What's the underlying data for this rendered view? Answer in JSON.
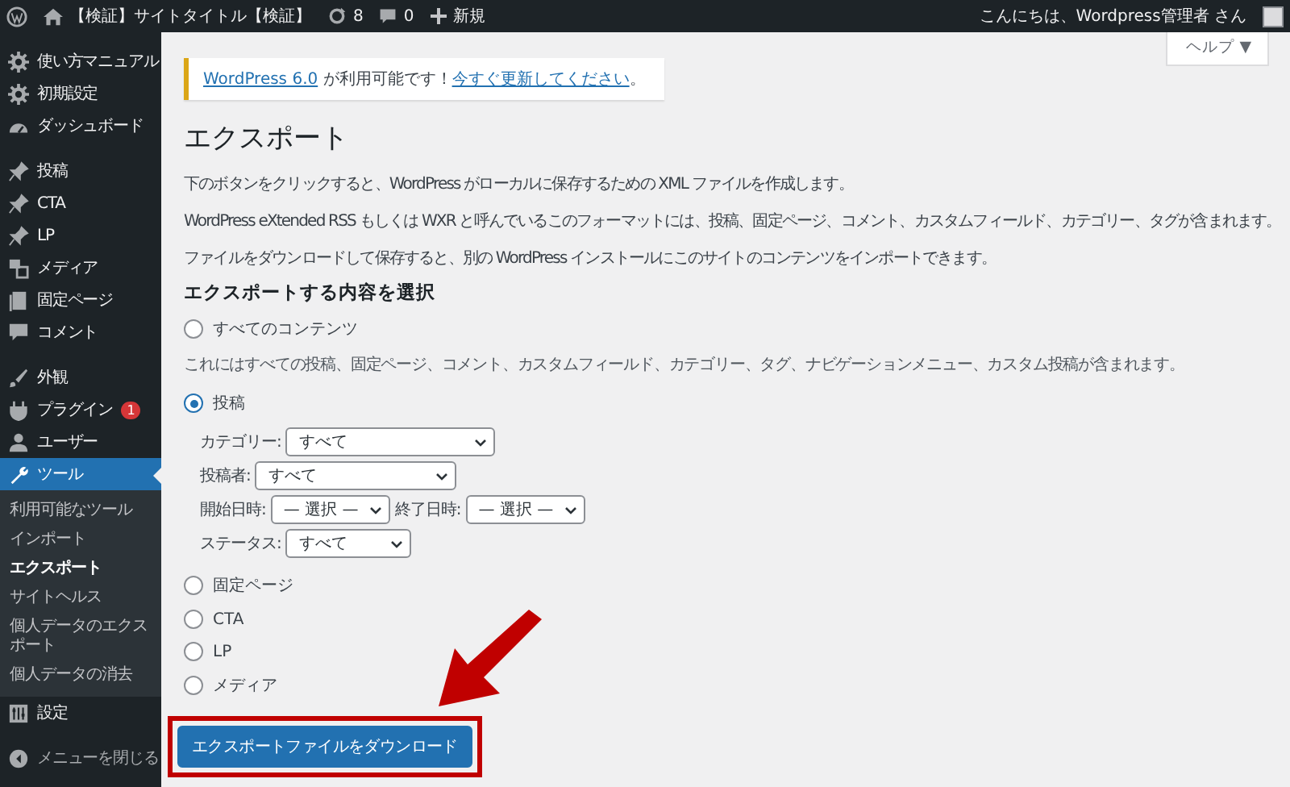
{
  "admin_bar": {
    "site_title": "【検証】サイトタイトル【検証】",
    "updates": "8",
    "comments": "0",
    "new_label": "新規",
    "greeting": "こんにちは、Wordpress管理者 さん"
  },
  "sidebar": {
    "groups": [
      {
        "items": [
          {
            "label": "使い方マニュアル",
            "selected": false
          },
          {
            "label": "初期設定",
            "selected": false
          },
          {
            "label": "ダッシュボード",
            "selected": false
          }
        ]
      },
      {
        "items": [
          {
            "label": "投稿",
            "selected": false
          },
          {
            "label": "CTA",
            "selected": false
          },
          {
            "label": "LP",
            "selected": false
          },
          {
            "label": "メディア",
            "selected": false
          },
          {
            "label": "固定ページ",
            "selected": false
          },
          {
            "label": "コメント",
            "selected": false
          }
        ]
      },
      {
        "items": [
          {
            "label": "外観",
            "selected": false
          },
          {
            "label": "プラグイン",
            "selected": false,
            "badge": "1"
          },
          {
            "label": "ユーザー",
            "selected": false
          },
          {
            "label": "ツール",
            "selected": true,
            "submenu": [
              {
                "label": "利用可能なツール",
                "selected": false
              },
              {
                "label": "インポート",
                "selected": false
              },
              {
                "label": "エクスポート",
                "selected": true
              },
              {
                "label": "サイトヘルス",
                "selected": false
              },
              {
                "label": "個人データのエクスポート",
                "selected": false
              },
              {
                "label": "個人データの消去",
                "selected": false
              }
            ]
          },
          {
            "label": "設定",
            "selected": false
          }
        ]
      }
    ],
    "collapse_label": "メニューを閉じる"
  },
  "help_tab": "ヘルプ ▼",
  "notice": {
    "link": "WordPress 6.0",
    "text": "が利用可能です！",
    "action": "今すぐ更新してください",
    "end": "。"
  },
  "page_title": "エクスポート",
  "intro": [
    "下のボタンをクリックすると、WordPress がローカルに保存するための XML ファイルを作成します。",
    "WordPress eXtended RSS もしくは WXR と呼んでいるこのフォーマットには、投稿、固定ページ、コメント、カスタムフィールド、カテゴリー、タグが含まれます。",
    "ファイルをダウンロードして保存すると、別の WordPress インストールにこのサイトのコンテンツをインポートできます。"
  ],
  "section_title": "エクスポートする内容を選択",
  "options": [
    {
      "label": "すべてのコンテンツ",
      "selected": false,
      "description": "これにはすべての投稿、固定ページ、コメント、カスタムフィールド、カテゴリー、タグ、ナビゲーションメニュー、カスタム投稿が含まれます。"
    },
    {
      "label": "投稿",
      "selected": true,
      "filter_rows": [
        [
          {
            "label": "カテゴリー:",
            "value": "すべて"
          }
        ],
        [
          {
            "label": "投稿者:",
            "value": "すべて"
          }
        ],
        [
          {
            "label": "開始日時:",
            "value": "— 選択 —"
          },
          {
            "label": "終了日時:",
            "value": "— 選択 —"
          }
        ],
        [
          {
            "label": "ステータス:",
            "value": "すべて"
          }
        ]
      ]
    },
    {
      "label": "固定ページ",
      "selected": false
    },
    {
      "label": "CTA",
      "selected": false
    },
    {
      "label": "LP",
      "selected": false
    },
    {
      "label": "メディア",
      "selected": false
    }
  ],
  "download_button": "エクスポートファイルをダウンロード"
}
